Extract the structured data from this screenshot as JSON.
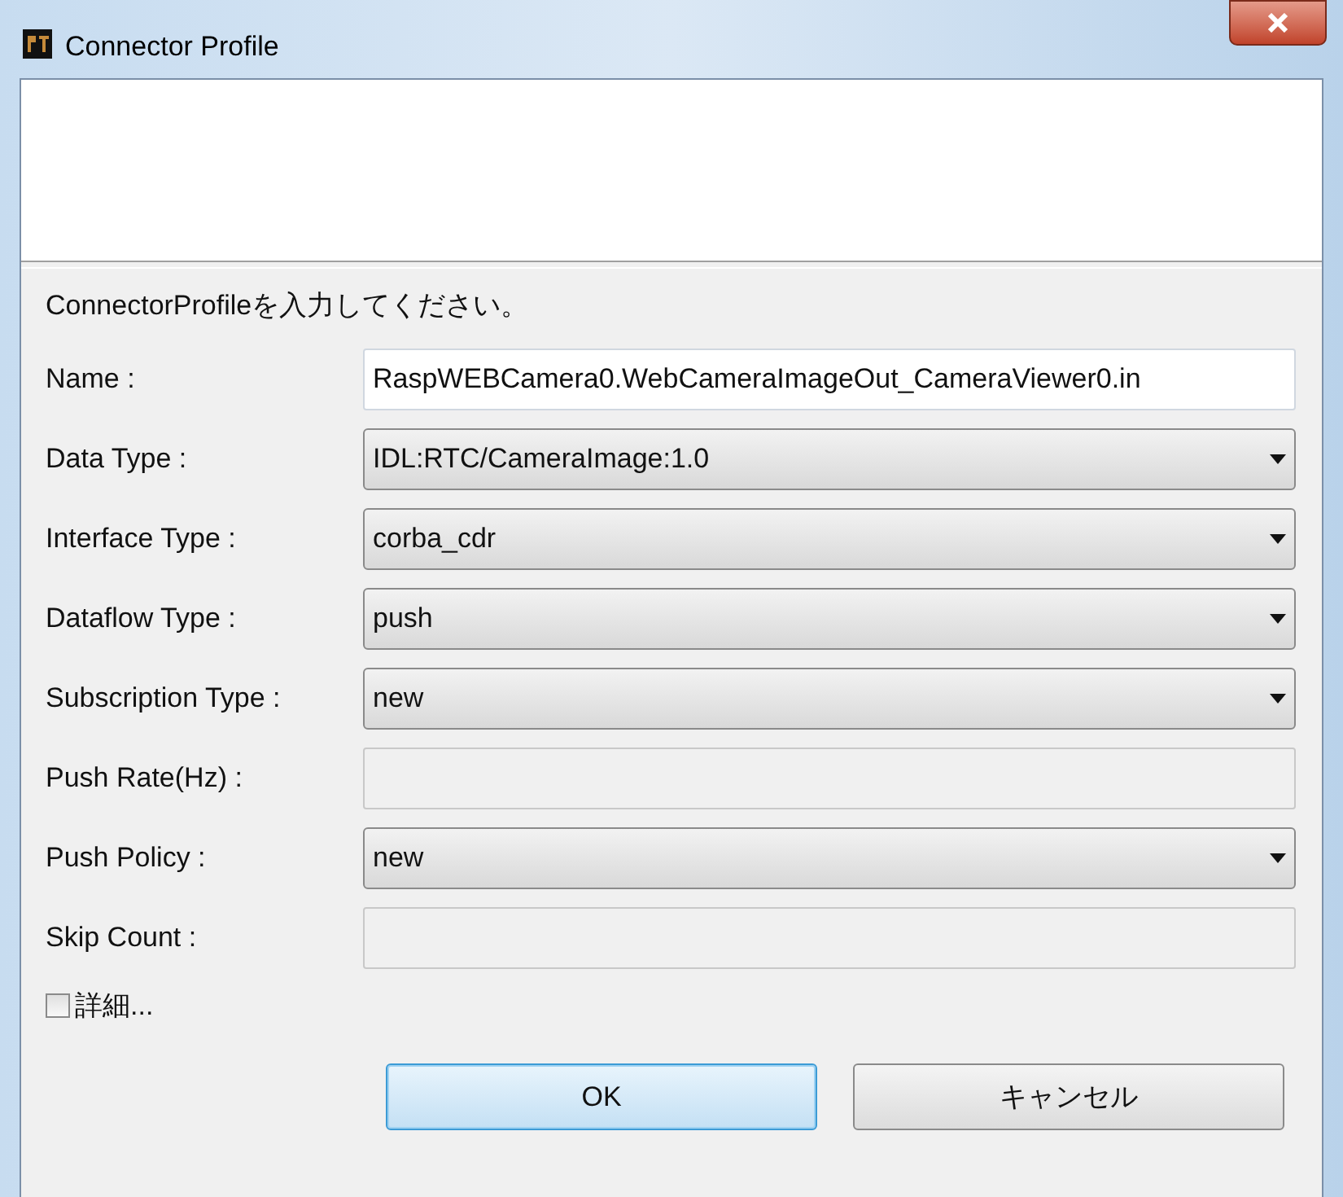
{
  "window": {
    "title": "Connector Profile"
  },
  "message": "ConnectorProfileを入力してください。",
  "fields": [
    {
      "label": "Name :",
      "kind": "text",
      "value": "RaspWEBCamera0.WebCameraImageOut_CameraViewer0.in",
      "disabled": false
    },
    {
      "label": "Data Type :",
      "kind": "select",
      "value": "IDL:RTC/CameraImage:1.0"
    },
    {
      "label": "Interface Type :",
      "kind": "select",
      "value": "corba_cdr"
    },
    {
      "label": "Dataflow Type :",
      "kind": "select",
      "value": "push"
    },
    {
      "label": "Subscription Type :",
      "kind": "select",
      "value": "new"
    },
    {
      "label": "Push Rate(Hz) :",
      "kind": "text",
      "disabled": true
    },
    {
      "label": "Push Policy :",
      "kind": "select",
      "value": "new"
    },
    {
      "label": "Skip Count :",
      "kind": "text",
      "disabled": true
    }
  ],
  "details": {
    "label": "詳細...",
    "checked": false
  },
  "buttons": [
    {
      "label": "OK",
      "selected": true
    },
    {
      "label": "キャンセル",
      "selected": false
    }
  ]
}
